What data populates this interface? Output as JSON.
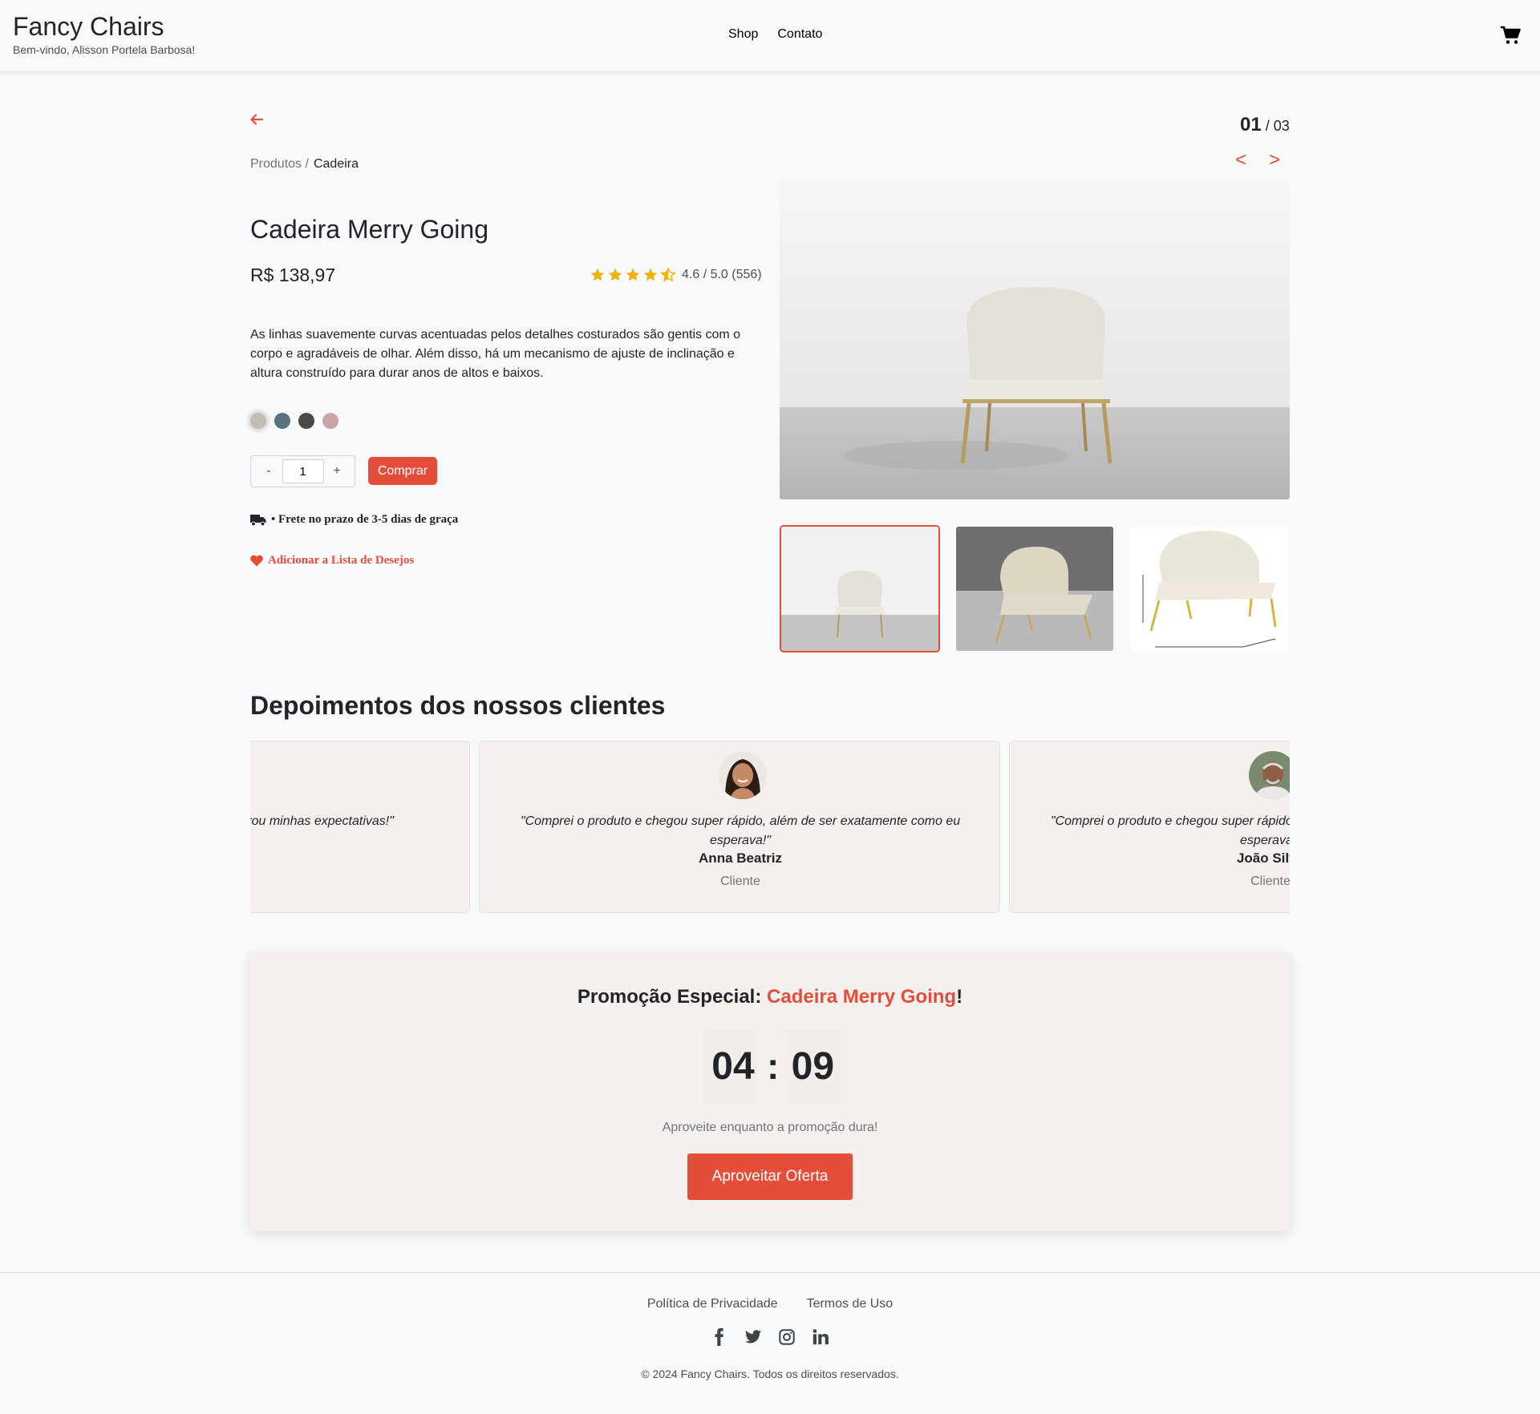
{
  "header": {
    "brand": "Fancy Chairs",
    "welcome": "Bem-vindo, Alisson Portela Barbosa!",
    "nav": [
      "Shop",
      "Contato"
    ]
  },
  "breadcrumb": {
    "parent": "Produtos /",
    "current": "Cadeira"
  },
  "product": {
    "title": "Cadeira Merry Going",
    "price": "R$ 138,97",
    "rating_value": 4.5,
    "rating_text": "4.6 / 5.0 (556)",
    "description": "As linhas suavemente curvas acentuadas pelos detalhes costurados são gentis com o corpo e agradáveis de olhar. Além disso, há um mecanismo de ajuste de inclinação e altura construído para durar anos de altos e baixos.",
    "colors": [
      "#c2bdb4",
      "#5a717f",
      "#4a4a4a",
      "#c9a4a6"
    ],
    "quantity": "1",
    "qty_minus": "-",
    "qty_plus": "+",
    "buy_label": "Comprar",
    "shipping": "• Frete no prazo de 3-5 dias de graça",
    "wishlist": "Adicionar a Lista de Desejos"
  },
  "gallery": {
    "current": "01",
    "total": "/ 03",
    "prev": "<",
    "next": ">"
  },
  "testimonials": {
    "title": "Depoimentos dos nossos clientes",
    "items": [
      {
        "quote": "\"Atendimento incrível e o produto superou minhas expectativas!\"",
        "name": "",
        "role": ""
      },
      {
        "quote": "\"Comprei o produto e chegou super rápido, além de ser exatamente como eu esperava!\"",
        "name": "Anna Beatriz",
        "role": "Cliente"
      },
      {
        "quote": "\"Comprei o produto e chegou super rápido, além de ser exatamente como eu esperava!\"",
        "name": "João Silva",
        "role": "Cliente"
      }
    ]
  },
  "promo": {
    "prefix": "Promoção Especial: ",
    "product": "Cadeira Merry Going",
    "suffix": "!",
    "minutes": "04",
    "separator": ":",
    "seconds": "09",
    "subtitle": "Aproveite enquanto a promoção dura!",
    "button": "Aproveitar Oferta"
  },
  "footer": {
    "links": [
      "Política de Privacidade",
      "Termos de Uso"
    ],
    "social": [
      "facebook-icon",
      "twitter-icon",
      "instagram-icon",
      "linkedin-icon"
    ],
    "copyright": "© 2024 Fancy Chairs. Todos os direitos reservados."
  },
  "colors": {
    "accent": "#e44d3a",
    "star": "#f5b301",
    "star_empty": "#6c757d"
  }
}
